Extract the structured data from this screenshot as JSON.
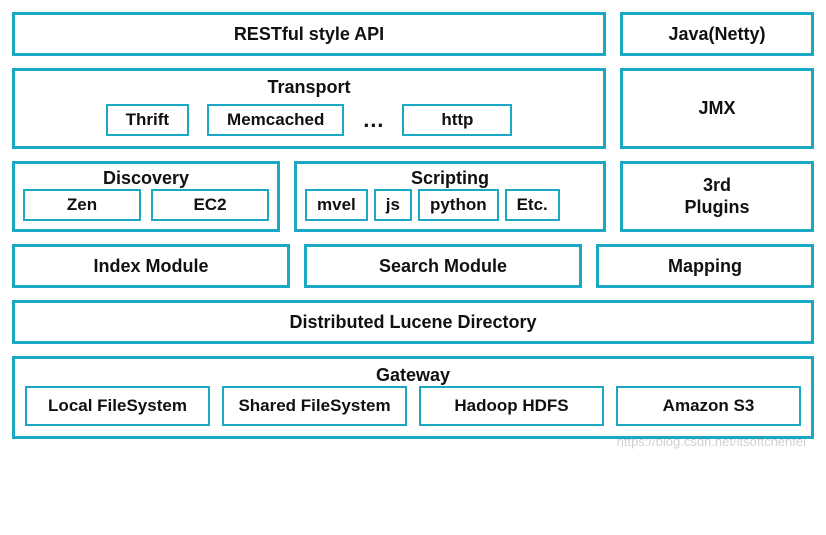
{
  "row1": {
    "restful": "RESTful style API",
    "java": "Java(Netty)"
  },
  "transport": {
    "title": "Transport",
    "items": [
      "Thrift",
      "Memcached",
      "http"
    ],
    "ellipsis": "…"
  },
  "jmx": "JMX",
  "discovery": {
    "title": "Discovery",
    "items": [
      "Zen",
      "EC2"
    ]
  },
  "scripting": {
    "title": "Scripting",
    "items": [
      "mvel",
      "js",
      "python",
      "Etc."
    ]
  },
  "plugins": {
    "line1": "3rd",
    "line2": "Plugins"
  },
  "row4": {
    "index": "Index Module",
    "search": "Search Module",
    "mapping": "Mapping"
  },
  "lucene": "Distributed Lucene Directory",
  "gateway": {
    "title": "Gateway",
    "items": [
      "Local FileSystem",
      "Shared FileSystem",
      "Hadoop HDFS",
      "Amazon S3"
    ]
  },
  "watermark": "https://blog.csdn.net/itsoftchenfei"
}
